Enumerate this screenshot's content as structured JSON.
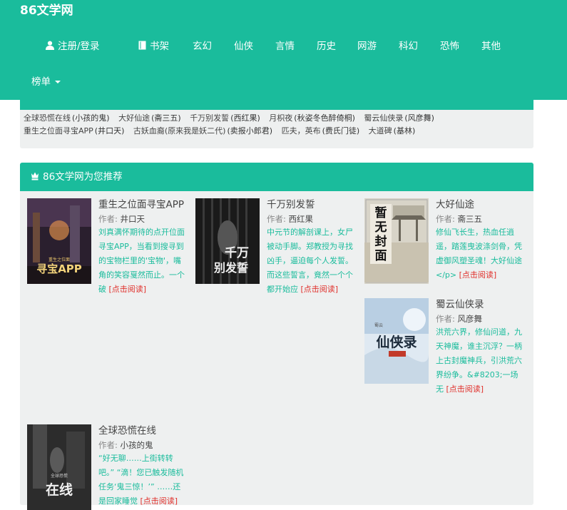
{
  "site": {
    "brand": "86文学网"
  },
  "nav": {
    "login": "注册/登录",
    "bookshelf": "书架",
    "categories": [
      "玄幻",
      "仙侠",
      "言情",
      "历史",
      "网游",
      "科幻",
      "恐怖",
      "其他"
    ],
    "ranking": "榜单"
  },
  "hot": {
    "row1": [
      {
        "title": "全球恐慌在线",
        "author": "(小孩的鬼)"
      },
      {
        "title": "大好仙途",
        "author": "(斋三五)"
      },
      {
        "title": "千万别发誓",
        "author": "(西红果)"
      },
      {
        "title": "月枳夜",
        "author": "(秋姿冬色醉倚桐)"
      },
      {
        "title": "蜀云仙侠录",
        "author": "(风彦舞)"
      }
    ],
    "row2": [
      {
        "title": "重生之位面寻宝APP",
        "author": "(井口天)"
      },
      {
        "title": "古妖血裔(原来我是妖二代)",
        "author": "(卖报小郎君)"
      },
      {
        "title": "匹夫，英布",
        "author": "(费氏门徒)"
      },
      {
        "title": "大道碑",
        "author": "(基林)"
      }
    ]
  },
  "recommend": {
    "title": "86文学网为您推荐",
    "author_label": "作者:",
    "read_label": "[点击阅读]",
    "books": [
      {
        "title": "重生之位面寻宝APP",
        "author": "井口天",
        "desc": "刘真满怀期待的点开位面寻宝APP，当看到搜寻到的宝物栏里的'宝物'，嘴角的笑容戛然而止。一个破"
      },
      {
        "title": "千万别发誓",
        "author": "西红果",
        "desc": "中元节的解剖课上，女尸被动手脚。郑教授为寻找凶手，逼迫每个人发誓。而这些誓言，竟然一个个都开始应"
      },
      {
        "title": "大好仙途",
        "author": "斋三五",
        "desc": "修仙飞长生，热血任逍遥，踏莲曳波涤剑骨，凭虚御风塑圣魂！大好仙途 </p>"
      },
      {
        "title": "蜀云仙侠录",
        "author": "风彦舞",
        "desc": "洪荒六界，修仙问道，九天神魔，谁主沉浮？一柄上古封魔神兵，引洪荒六界纷争。&#8203;一场无"
      },
      {
        "title": "全球恐慌在线",
        "author": "小孩的鬼",
        "desc": "“好无聊……上街转转吧。” “滴！您已触发随机任务‘鬼三惊！’” ……还是回家睡觉"
      }
    ],
    "cover_texts": [
      [
        "寻宝APP",
        "重生之位面"
      ],
      [
        "千万",
        "别发誓"
      ],
      [
        "暂",
        "无",
        "封",
        "面"
      ],
      [
        "仙侠录",
        "蜀云"
      ],
      [
        "在线",
        "全球恐慌"
      ]
    ]
  },
  "colors": {
    "primary": "#1abc9c",
    "read_link": "#e0312c",
    "panel": "#eef0f0"
  }
}
